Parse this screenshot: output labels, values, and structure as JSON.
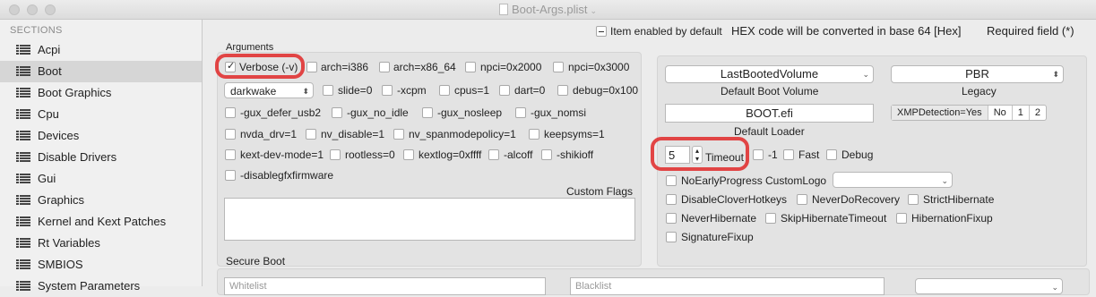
{
  "window": {
    "title": "Boot-Args.plist"
  },
  "sidebar": {
    "heading": "SECTIONS",
    "items": [
      {
        "label": "Acpi"
      },
      {
        "label": "Boot"
      },
      {
        "label": "Boot Graphics"
      },
      {
        "label": "Cpu"
      },
      {
        "label": "Devices"
      },
      {
        "label": "Disable Drivers"
      },
      {
        "label": "Gui"
      },
      {
        "label": "Graphics"
      },
      {
        "label": "Kernel and Kext Patches"
      },
      {
        "label": "Rt Variables"
      },
      {
        "label": "SMBIOS"
      },
      {
        "label": "System Parameters"
      }
    ],
    "selected": "Boot"
  },
  "legend": {
    "item_enabled": "Item enabled by default",
    "hex_note": "HEX code will be converted in base 64 [Hex]",
    "required": "Required field (*)"
  },
  "arguments": {
    "title": "Arguments",
    "verbose": "Verbose (-v)",
    "arch_i386": "arch=i386",
    "arch_x86_64": "arch=x86_64",
    "npci_2000": "npci=0x2000",
    "npci_3000": "npci=0x3000",
    "darkwake": "darkwake",
    "slide": "slide=0",
    "xcpm": "-xcpm",
    "cpus": "cpus=1",
    "dart": "dart=0",
    "debug": "debug=0x100",
    "gux_defer_usb2": "-gux_defer_usb2",
    "gux_no_idle": "-gux_no_idle",
    "gux_nosleep": "-gux_nosleep",
    "gux_nomsi": "-gux_nomsi",
    "nvda_drv": "nvda_drv=1",
    "nv_disable": "nv_disable=1",
    "nv_spanmodepolicy": "nv_spanmodepolicy=1",
    "keepsyms": "keepsyms=1",
    "kext_dev_mode": "kext-dev-mode=1",
    "rootless": "rootless=0",
    "kextlog": "kextlog=0xffff",
    "alcoff": "-alcoff",
    "shikioff": "-shikioff",
    "disablegfxfirmware": "-disablegfxfirmware",
    "custom_flags": "Custom Flags"
  },
  "boot": {
    "default_volume_value": "LastBootedVolume",
    "default_volume_label": "Default Boot Volume",
    "legacy_value": "PBR",
    "legacy_label": "Legacy",
    "default_loader_value": "BOOT.efi",
    "default_loader_label": "Default Loader",
    "xmp_label": "XMPDetection=Yes",
    "xmp_no": "No",
    "xmp_1": "1",
    "xmp_2": "2",
    "timeout_value": "5",
    "timeout_label": "Timeout",
    "minus_one": "-1",
    "fast": "Fast",
    "debug": "Debug",
    "no_early_progress": "NoEarlyProgress",
    "custom_logo": "CustomLogo",
    "disable_clover_hotkeys": "DisableCloverHotkeys",
    "never_do_recovery": "NeverDoRecovery",
    "strict_hibernate": "StrictHibernate",
    "never_hibernate": "NeverHibernate",
    "skip_hibernate_timeout": "SkipHibernateTimeout",
    "hibernation_fixup": "HibernationFixup",
    "signature_fixup": "SignatureFixup"
  },
  "secure_boot": {
    "title": "Secure Boot",
    "whitelist": "Whitelist",
    "blacklist": "Blacklist"
  },
  "colors": {
    "highlight_ring": "#e12828",
    "selected_row": "#d6d6d6"
  }
}
